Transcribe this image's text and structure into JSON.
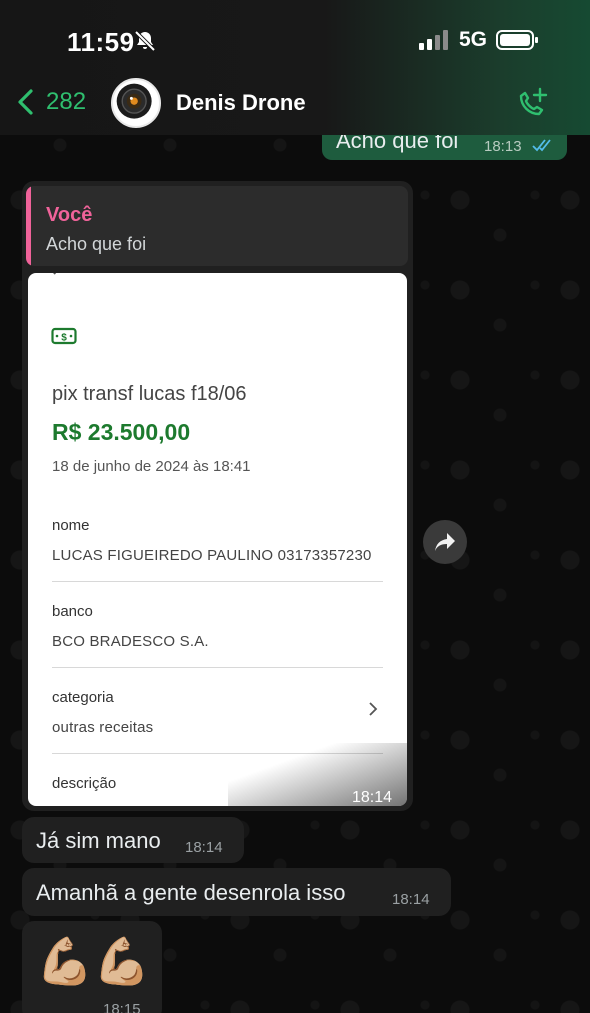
{
  "status_bar": {
    "time": "11:59",
    "network": "5G",
    "mute_icon": "bell-slash-icon",
    "signal_icon": "signal-bars-icon",
    "battery_icon": "battery-icon"
  },
  "header": {
    "back_icon": "chevron-left-icon",
    "back_count": "282",
    "contact_name": "Denis Drone",
    "avatar_icon": "camera-lens-avatar",
    "call_icon": "add-call-icon"
  },
  "messages": {
    "out_partial": {
      "text": "Acho que foi",
      "time": "18:13",
      "status_icon": "double-check-read-icon"
    },
    "image_reply": {
      "quote_author": "Você",
      "quote_text": "Acho que foi",
      "time": "18:14",
      "receipt": {
        "title": "pix transf lucas f18/06",
        "amount": "R$ 23.500,00",
        "date": "18 de junho de 2024 às 18:41",
        "fields": [
          {
            "label": "nome",
            "value": "LUCAS FIGUEIREDO PAULINO 03173357230"
          },
          {
            "label": "banco",
            "value": "BCO BRADESCO S.A."
          },
          {
            "label": "categoria",
            "value": "outras receitas"
          },
          {
            "label": "descrição",
            "value": ""
          }
        ]
      }
    },
    "in1": {
      "text": "Já sim mano",
      "time": "18:14"
    },
    "in2": {
      "text": "Amanhã a gente desenrola isso",
      "time": "18:14"
    },
    "in3": {
      "text": "💪🏼💪🏼",
      "time": "18:15"
    }
  },
  "colors": {
    "accent_green": "#2fbf6f",
    "outgoing_bubble": "#1e5c3e",
    "incoming_bubble": "#202020",
    "quote_author": "#f0639a",
    "amount_green": "#1d7a2e",
    "read_ticks": "#53bdeb"
  }
}
